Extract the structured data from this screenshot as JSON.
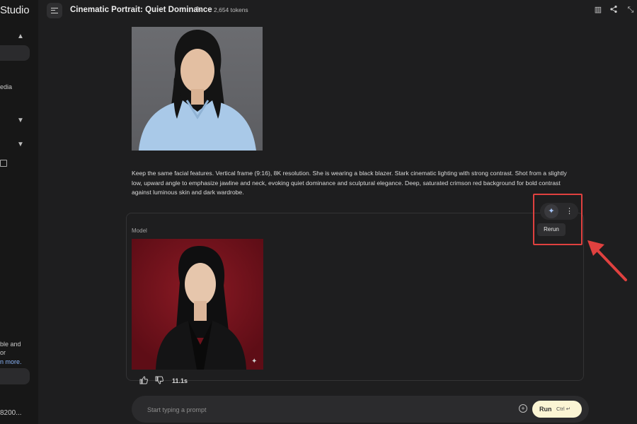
{
  "sidebar": {
    "brand": "Studio",
    "fragments": {
      "media": "edia",
      "note_line1": "ble and",
      "note_line2": "or",
      "learn_more": "n more.",
      "account": "8200..."
    }
  },
  "header": {
    "title": "Cinematic Portrait: Quiet Dominance",
    "tokens": "2,654 tokens"
  },
  "conversation": {
    "prompt_text": "Keep the same facial features. Vertical frame (9:16), 8K resolution. She is wearing a black blazer. Stark cinematic lighting with strong contrast. Shot from a slightly low, upward angle to emphasize jawline and neck, evoking quiet dominance and sculptural elegance. Deep, saturated crimson red background for bold contrast against luminous skin and dark wardrobe.",
    "model_label": "Model",
    "rerun_label": "Rerun",
    "elapsed": "11.1s"
  },
  "input": {
    "placeholder": "Start typing a prompt",
    "run_label": "Run",
    "run_shortcut": "Ctrl ↵"
  },
  "colors": {
    "annotation": "#e0413f",
    "run_button": "#fbf5d4",
    "link": "#8ab4f8"
  }
}
